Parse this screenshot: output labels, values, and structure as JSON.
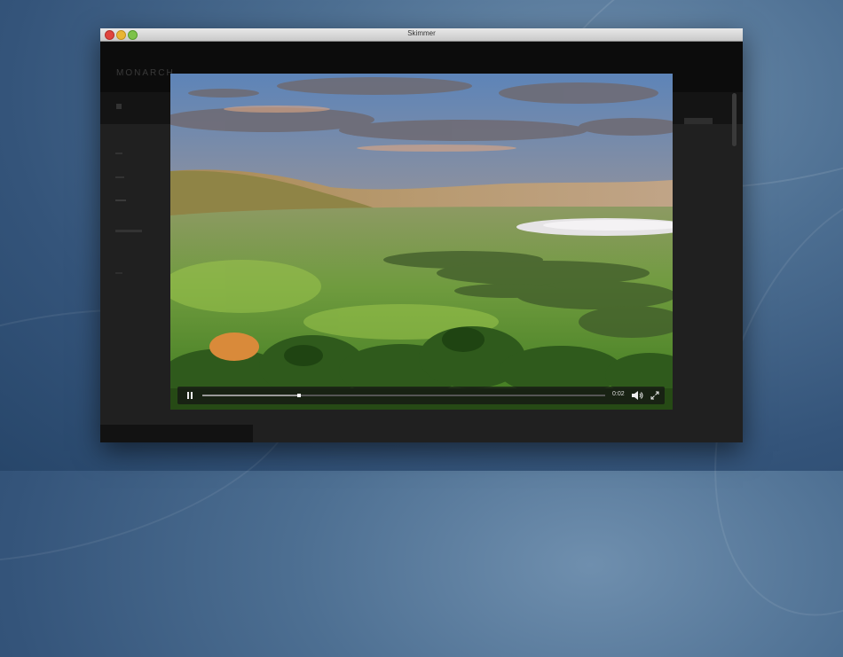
{
  "window": {
    "title": "Skimmer"
  },
  "app": {
    "brand": "MONARCH"
  },
  "video": {
    "elapsed": "0:02",
    "progress": 0.24,
    "state": "playing",
    "icons": {
      "pause": "pause-icon",
      "volume": "volume-icon",
      "fullscreen": "fullscreen-icon"
    }
  },
  "colors": {
    "close": "#e0443e",
    "minimize": "#e9b534",
    "maximize": "#7dc24a",
    "overlay": "#000000"
  }
}
